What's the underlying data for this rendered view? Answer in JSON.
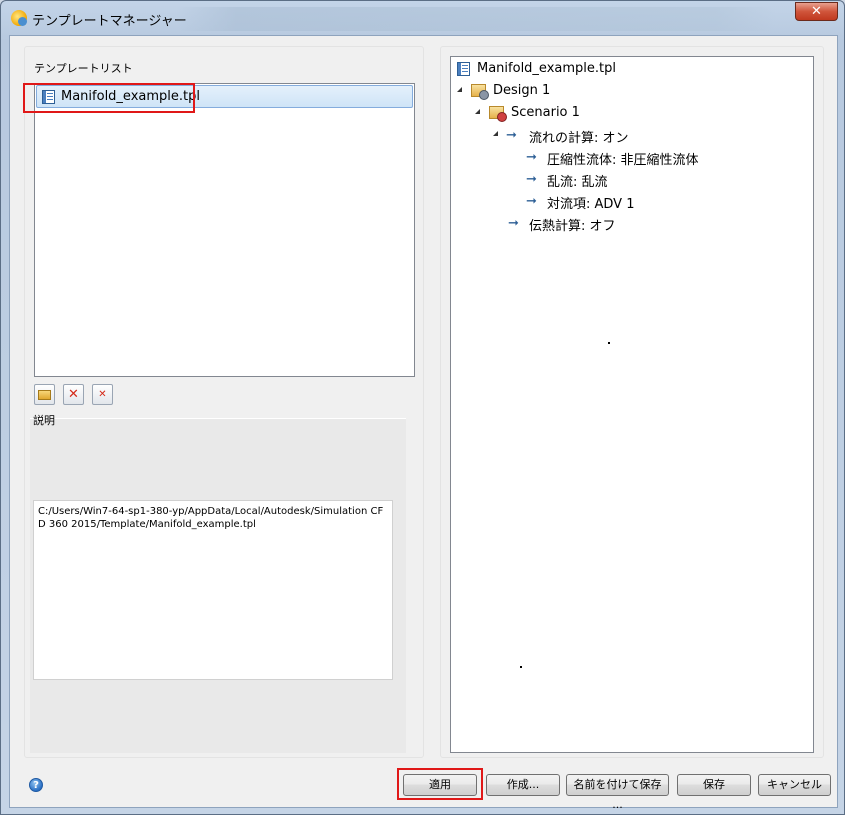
{
  "window": {
    "title": "テンプレートマネージャー",
    "close_glyph": "✕"
  },
  "left": {
    "list_label": "テンプレートリスト",
    "templates": [
      {
        "name": "Manifold_example.tpl",
        "icon": "template-file-icon",
        "selected": true
      }
    ],
    "toolbar": {
      "open_icon": "folder-open-icon",
      "delete_icon": "delete-icon",
      "delete_all_icon": "delete-all-icon",
      "delete_glyph": "✕",
      "delete_all_glyph": "✕"
    },
    "description_label": "説明",
    "description_text": "C:/Users/Win7-64-sp1-380-yp/AppData/Local/Autodesk/Simulation CFD 360 2015/Template/Manifold_example.tpl"
  },
  "tree": {
    "root": "Manifold_example.tpl",
    "design": "Design 1",
    "scenario": "Scenario 1",
    "flow": "流れの計算: オン",
    "compressible": "圧縮性流体: 非圧縮性流体",
    "turbulence": "乱流: 乱流",
    "advection": "対流項: ADV 1",
    "heat": "伝熱計算: オフ",
    "arrow_glyph": "➞"
  },
  "buttons": {
    "apply": "適用",
    "create": "作成...",
    "save_as": "名前を付けて保存 ...",
    "save": "保存",
    "cancel": "キャンセル",
    "help": "?"
  },
  "colors": {
    "highlight": "#e01818",
    "selection": "#cfe4f7"
  }
}
